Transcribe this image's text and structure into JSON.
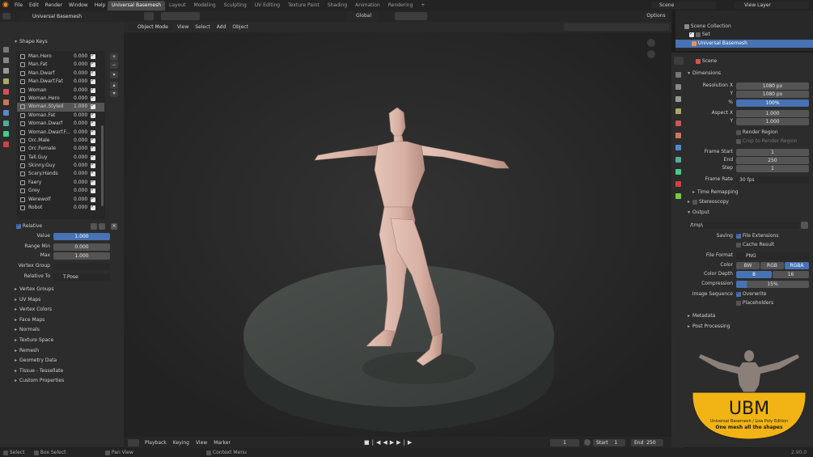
{
  "menus": [
    "File",
    "Edit",
    "Render",
    "Window",
    "Help"
  ],
  "workspaces": [
    "Universal Basemesh",
    "Layout",
    "Modeling",
    "Sculpting",
    "UV Editing",
    "Texture Paint",
    "Shading",
    "Animation",
    "Rendering"
  ],
  "scene_name": "Scene",
  "view_layer": "View Layer",
  "left_header": {
    "object_name": "Universal Basemesh",
    "mode": "Object Mode"
  },
  "viewport_menus": [
    "View",
    "Select",
    "Add",
    "Object"
  ],
  "orientation": "Global",
  "options_label": "Options",
  "shape_keys": {
    "title": "Shape Keys",
    "items": [
      {
        "name": "Man.Hero",
        "value": "0.000"
      },
      {
        "name": "Man.Fat",
        "value": "0.000"
      },
      {
        "name": "Man.Dwarf",
        "value": "0.000"
      },
      {
        "name": "Man.Dwarf.Fat",
        "value": "0.000"
      },
      {
        "name": "Woman",
        "value": "0.000"
      },
      {
        "name": "Woman.Hero",
        "value": "0.000"
      },
      {
        "name": "Woman.Styled",
        "value": "1.000",
        "selected": true
      },
      {
        "name": "Woman.Fat",
        "value": "0.000"
      },
      {
        "name": "Woman.Dwarf",
        "value": "0.000"
      },
      {
        "name": "Woman.Dwarf.F...",
        "value": "0.000"
      },
      {
        "name": "Orc.Male",
        "value": "0.000"
      },
      {
        "name": "Orc.Female",
        "value": "0.000"
      },
      {
        "name": "Tall.Guy",
        "value": "0.000"
      },
      {
        "name": "Skinny.Guy",
        "value": "0.000"
      },
      {
        "name": "Scary.Hands",
        "value": "0.000"
      },
      {
        "name": "Faery",
        "value": "0.000"
      },
      {
        "name": "Grey",
        "value": "0.000"
      },
      {
        "name": "Werewolf",
        "value": "0.000"
      },
      {
        "name": "Robot",
        "value": "0.000"
      }
    ],
    "relative_label": "Relative",
    "value_label": "Value",
    "value": "1.000",
    "range_min_label": "Range Min",
    "range_min": "0.000",
    "max_label": "Max",
    "max": "1.000",
    "vertex_group_label": "Vertex Group",
    "relative_to_label": "Relative To",
    "relative_to": "T.Pose"
  },
  "left_panels": [
    "Vertex Groups",
    "UV Maps",
    "Vertex Colors",
    "Face Maps",
    "Normals",
    "Texture Space",
    "Remesh",
    "Geometry Data",
    "Tissue - Tessellate",
    "Custom Properties"
  ],
  "outliner": {
    "scene_collection": "Scene Collection",
    "items": [
      "Set",
      "Universal Basemesh"
    ]
  },
  "properties": {
    "scene_label": "Scene",
    "dimensions_title": "Dimensions",
    "resolution_x_label": "Resolution X",
    "resolution_x": "1080 px",
    "y_label": "Y",
    "resolution_y": "1080 px",
    "percent_label": "%",
    "percent": "100%",
    "aspect_x_label": "Aspect X",
    "aspect_x": "1.000",
    "aspect_y": "1.000",
    "render_region": "Render Region",
    "crop_region": "Crop to Render Region",
    "frame_start_label": "Frame Start",
    "frame_start": "1",
    "end_label": "End",
    "frame_end": "250",
    "step_label": "Step",
    "frame_step": "1",
    "frame_rate_label": "Frame Rate",
    "frame_rate": "30 fps",
    "time_remapping": "Time Remapping",
    "stereoscopy": "Stereoscopy",
    "output_title": "Output",
    "output_path": "/tmp\\",
    "saving_label": "Saving",
    "file_extensions": "File Extensions",
    "cache_result": "Cache Result",
    "file_format_label": "File Format",
    "file_format": "PNG",
    "color_label": "Color",
    "color_options": [
      "BW",
      "RGB",
      "RGBA"
    ],
    "color_depth_label": "Color Depth",
    "color_depth_options": [
      "8",
      "16"
    ],
    "compression_label": "Compression",
    "compression": "15%",
    "image_sequence_label": "Image Sequence",
    "overwrite": "Overwrite",
    "placeholders": "Placeholders",
    "metadata": "Metadata",
    "post_processing": "Post Processing"
  },
  "logo": {
    "title": "UBM",
    "subtitle": "Universal Basemesh / Low Poly Edition",
    "tagline": "One mesh all the shapes"
  },
  "timeline": {
    "menus": [
      "Playback",
      "Keying",
      "View",
      "Marker"
    ],
    "current_frame": "1",
    "start_label": "Start",
    "start": "1",
    "end_label": "End",
    "end": "250"
  },
  "status": {
    "select": "Select",
    "box_select": "Box Select",
    "pan_view": "Pan View",
    "context_menu": "Context Menu",
    "version": "2.90.0"
  },
  "colors": {
    "accent": "#4772b3",
    "header": "#232323",
    "panel": "#2c2c2c",
    "viewport": "#262626",
    "logo_gold": "#f2b415"
  }
}
